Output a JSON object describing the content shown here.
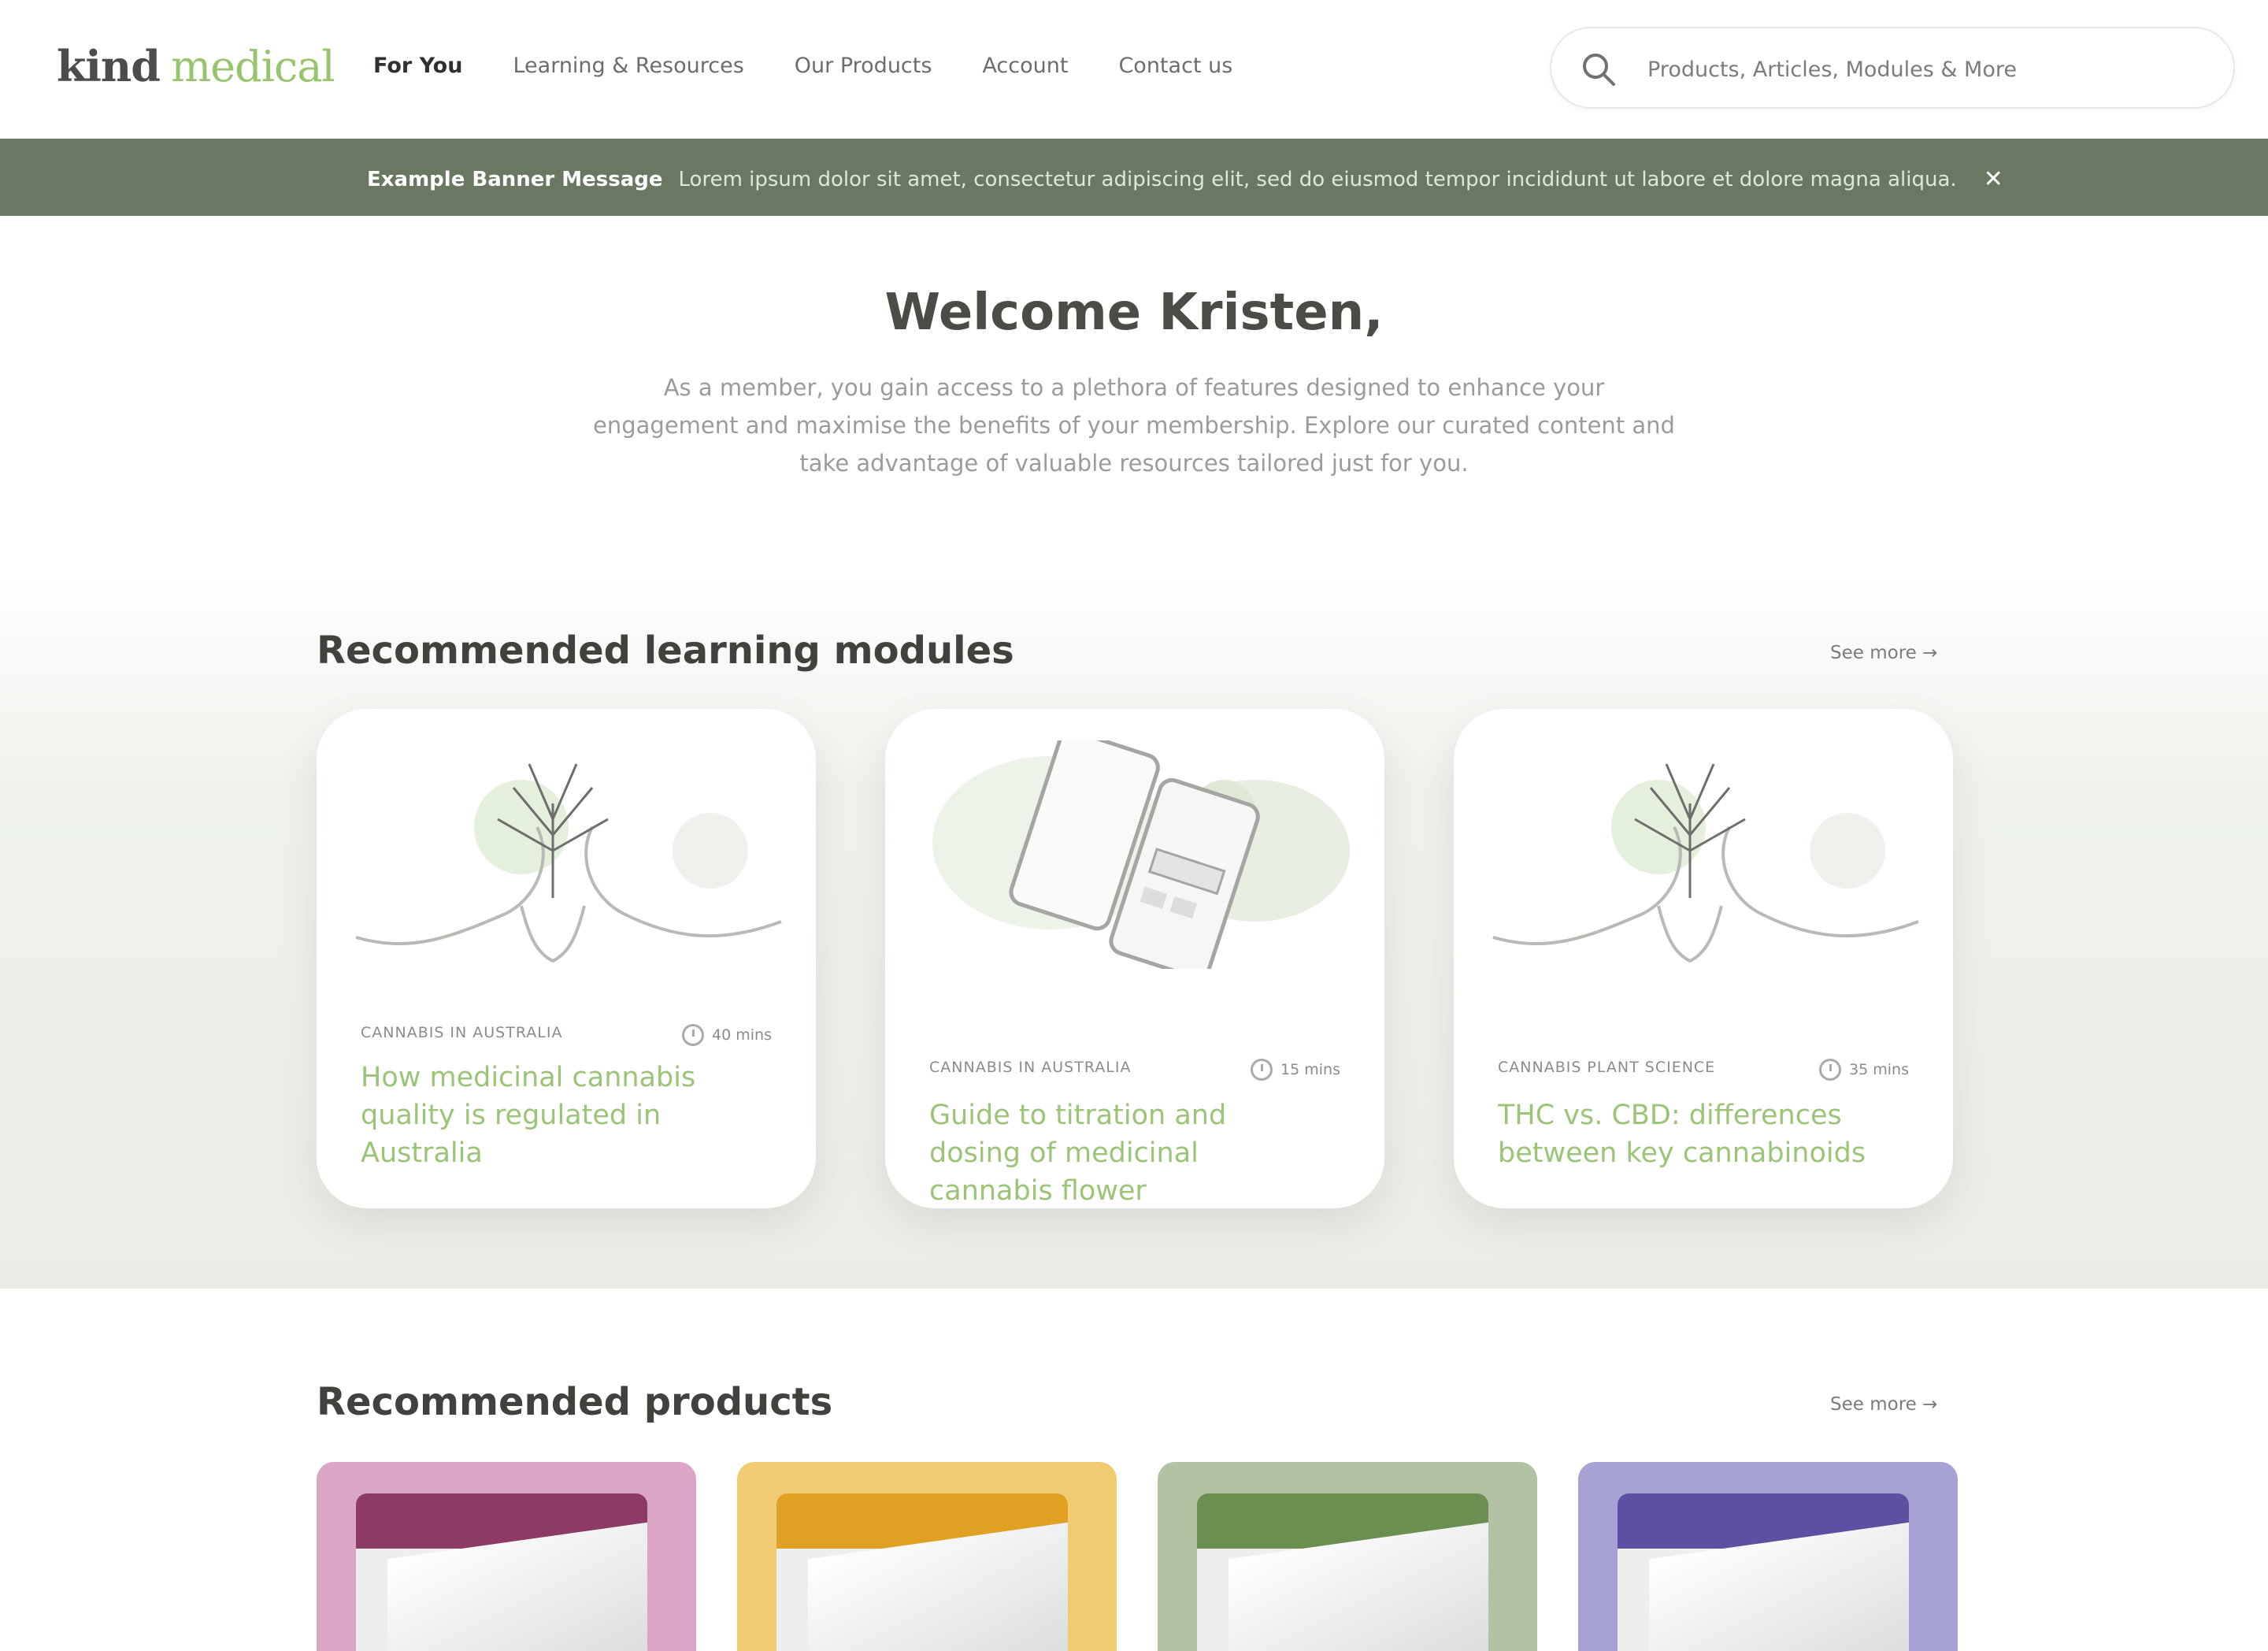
{
  "header": {
    "logo": {
      "part1": "kind",
      "part2": "medical"
    },
    "nav": [
      "For You",
      "Learning & Resources",
      "Our Products",
      "Account",
      "Contact us"
    ],
    "search_placeholder": "Products, Articles, Modules & More"
  },
  "banner": {
    "title": "Example Banner Message",
    "text": "Lorem ipsum dolor sit amet, consectetur adipiscing elit, sed do eiusmod tempor incididunt ut labore et dolore magna aliqua.",
    "close": "✕"
  },
  "welcome": {
    "heading": "Welcome Kristen,",
    "body": "As a member, you gain access to a plethora of features designed to enhance your engagement and maximise the benefits of your membership. Explore our curated content and take advantage of valuable resources tailored just for you."
  },
  "modules": {
    "title": "Recommended learning modules",
    "see_more": "See more →",
    "cards": [
      {
        "category": "CANNABIS IN AUSTRALIA",
        "duration": "40 mins",
        "title": "How medicinal cannabis quality is regulated in Australia"
      },
      {
        "category": "CANNABIS IN AUSTRALIA",
        "duration": "15 mins",
        "title": "Guide to titration and dosing of medicinal cannabis flower"
      },
      {
        "category": "CANNABIS PLANT SCIENCE",
        "duration": "35 mins",
        "title": "THC vs. CBD: differences between key cannabinoids"
      }
    ]
  },
  "products": {
    "title": "Recommended products",
    "see_more": "See more →",
    "items": [
      {
        "color": "#dba5c6",
        "accent": "#8e3a66"
      },
      {
        "color": "#f1cb73",
        "accent": "#e0a021"
      },
      {
        "color": "#b3c2a3",
        "accent": "#6a8f50"
      },
      {
        "color": "#a7a2d4",
        "accent": "#5c50a3"
      }
    ]
  }
}
